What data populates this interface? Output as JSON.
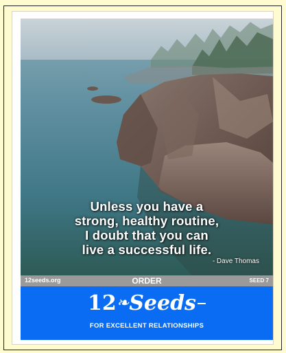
{
  "poster": {
    "quote_lines": [
      "Unless you have a",
      "strong, healthy routine,",
      "I doubt that you can",
      "live a successful life."
    ],
    "author": "- Dave Thomas",
    "footer": {
      "site": "12seeds.org",
      "order_label": "ORDER",
      "seed_label": "SEED 7"
    },
    "brand": {
      "number": "12",
      "leaf_icon": "wheat-icon",
      "name": "Seeds",
      "tagline": "FOR EXCELLENT RELATIONSHIPS"
    },
    "colors": {
      "background": "#fffbd0",
      "strip": "#9a9a9a",
      "banner": "#0a6cf2"
    }
  }
}
